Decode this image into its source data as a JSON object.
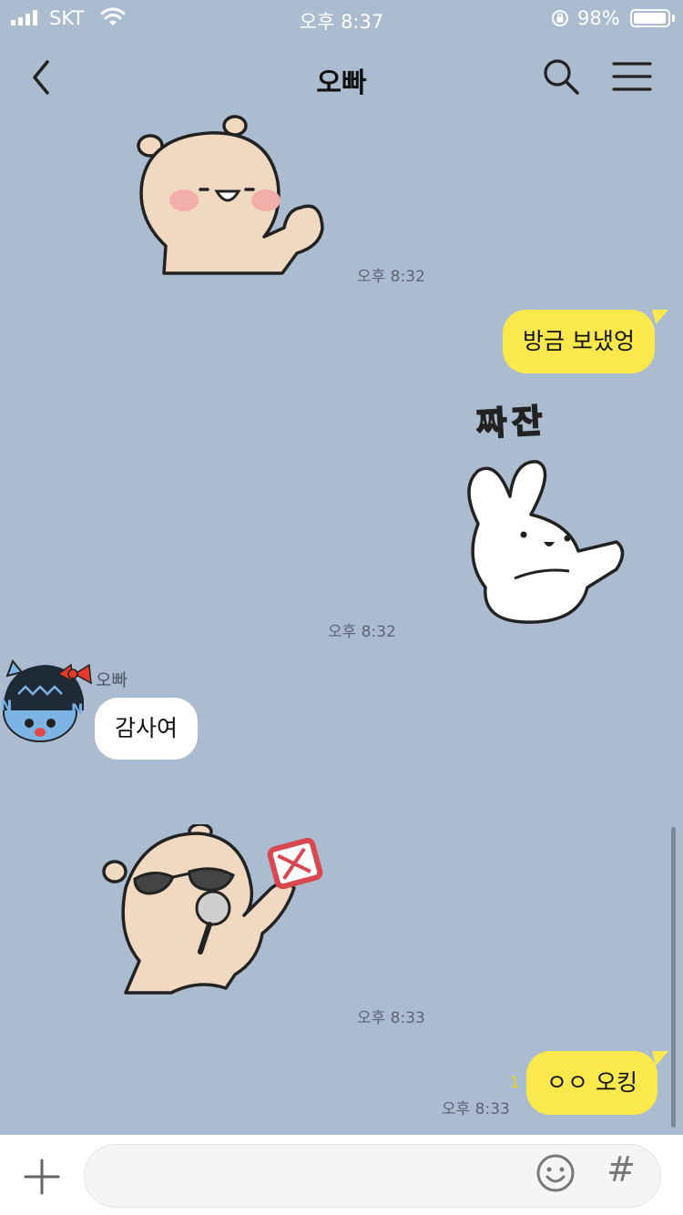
{
  "status_bar": {
    "carrier": "SKT",
    "time": "오후 8:37",
    "battery": "98%",
    "battery_level": 0.98
  },
  "header": {
    "title": "오빠"
  },
  "messages": {
    "m1": {
      "time": "오후 8:32"
    },
    "m2": {
      "text": "방금 보냈엉"
    },
    "m3": {
      "caption": "짜잔",
      "time": "오후 8:32"
    },
    "m4": {
      "sender": "오빠",
      "text": "감사여"
    },
    "m5": {
      "time": "오후 8:33"
    },
    "m6": {
      "text": "ㅇㅇ 오킹",
      "unread": "1",
      "time": "오후 8:33"
    }
  },
  "input": {
    "placeholder": "",
    "hash": "#"
  },
  "colors": {
    "background": "#abbcd0",
    "my_bubble": "#fae84c",
    "other_bubble": "#ffffff"
  }
}
